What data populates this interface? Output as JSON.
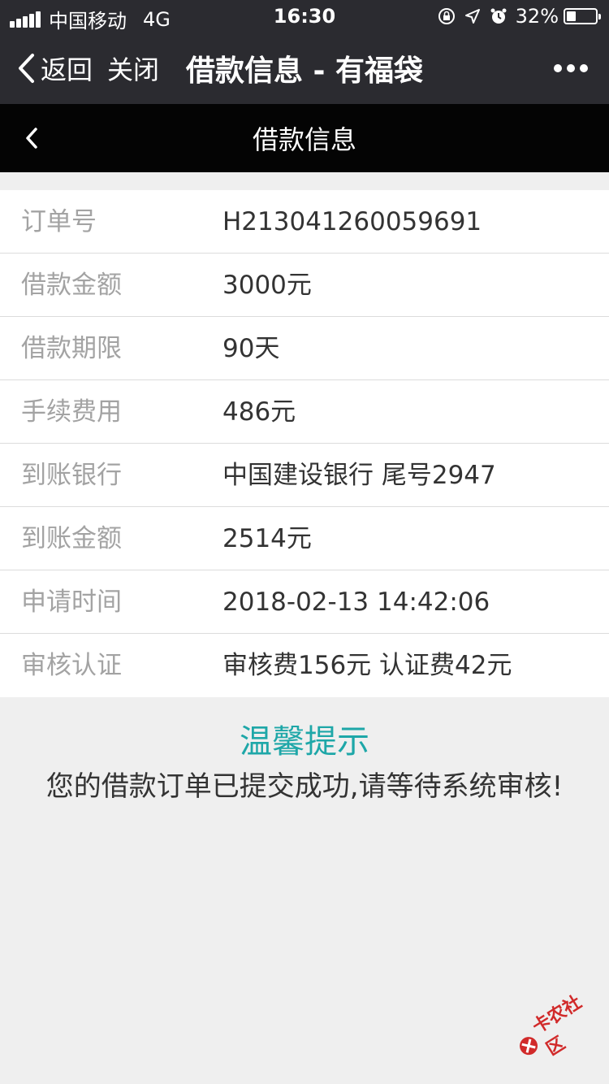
{
  "status_bar": {
    "carrier": "中国移动",
    "network": "4G",
    "time": "16:30",
    "battery_percent": "32%",
    "battery_level": 0.32
  },
  "wechat_nav": {
    "back_label": "返回",
    "close_label": "关闭",
    "title": "借款信息 - 有福袋"
  },
  "page_header": {
    "title": "借款信息"
  },
  "loan_info": {
    "rows": [
      {
        "label": "订单号",
        "value": "H213041260059691"
      },
      {
        "label": "借款金额",
        "value": "3000元"
      },
      {
        "label": "借款期限",
        "value": "90天"
      },
      {
        "label": "手续费用",
        "value": "486元"
      },
      {
        "label": "到账银行",
        "value": "中国建设银行 尾号2947"
      },
      {
        "label": "到账金额",
        "value": "2514元"
      },
      {
        "label": "申请时间",
        "value": "2018-02-13 14:42:06"
      },
      {
        "label": "审核认证",
        "value": "审核费156元 认证费42元"
      }
    ]
  },
  "tip": {
    "title": "温馨提示",
    "message": "您的借款订单已提交成功,请等待系统审核!"
  },
  "watermark": {
    "text": "卡农社区"
  },
  "colors": {
    "nav_bg": "#2b2b30",
    "header_bg": "#040404",
    "tip_title": "#1ea7a8",
    "label": "#a3a3a3",
    "value": "#333333",
    "page_bg": "#efefef"
  }
}
